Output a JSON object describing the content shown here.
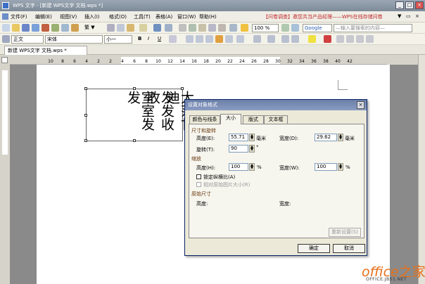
{
  "window": {
    "title": "WPS 文字 - [新建 WPS文字 文档.wps *]",
    "min": "_",
    "max": "□",
    "close": "×"
  },
  "menu": {
    "items": [
      "文件(F)",
      "编辑(E)",
      "视图(V)",
      "插入(I)",
      "格式(O)",
      "工具(T)",
      "表格(A)",
      "窗口(W)",
      "帮助(H)"
    ],
    "promo": "【问卷调查】邀您共当产品经理——WPS在线存储问卷",
    "controls": [
      "▼",
      "▭",
      "×"
    ]
  },
  "toolbar1": {
    "complex": "繁 ▼",
    "zoom": "100 %",
    "google": "Google",
    "search_placeholder": "—输入要搜索的内容—"
  },
  "toolbar2": {
    "style": "正文",
    "font": "宋体",
    "size": "小一",
    "bold": "B",
    "italic": "I",
    "underline": "U"
  },
  "doc_tab": {
    "label": "新建 WPS文字 文档.wps *"
  },
  "ruler": {
    "numbers": [
      "10",
      "8",
      "6",
      "4",
      "2",
      "2",
      "4",
      "6",
      "8",
      "10",
      "12",
      "14",
      "16",
      "18",
      "20",
      "22",
      "24",
      "26",
      "28",
      "30",
      "32",
      "34",
      "36",
      "38",
      "40",
      "42"
    ]
  },
  "textbox": {
    "lines": [
      "大范甘迪",
      "发发收收",
      "室室发发"
    ]
  },
  "dialog": {
    "title": "设置对象格式",
    "tabs": [
      "颜色与线条",
      "大小",
      "版式",
      "文本框"
    ],
    "active_tab": "大小",
    "size_rotate": {
      "section": "尺寸和旋转",
      "height_label": "高度(E):",
      "height_value": "55.71",
      "height_unit": "毫米",
      "width_label": "宽度(D):",
      "width_value": "29.62",
      "width_unit": "毫米",
      "rotate_label": "旋转(T):",
      "rotate_value": "90",
      "rotate_unit": "°"
    },
    "scale": {
      "section": "缩放",
      "height_label": "高度(H):",
      "height_value": "100",
      "height_unit": "%",
      "width_label": "宽度(W):",
      "width_value": "100",
      "width_unit": "%",
      "lock_ratio": "锁定纵横比(A)",
      "relative": "相对原始图片大小(R)"
    },
    "original": {
      "section": "原始尺寸",
      "height_label": "高度:",
      "width_label": "宽度:"
    },
    "reset": "重新设置(S)",
    "ok": "确定",
    "cancel": "取消"
  },
  "watermark": {
    "brand": "office",
    "brand_cn": "之家",
    "site": "OFFICE.JB51.NET"
  },
  "colors": {
    "title_bar": "#7d8a98",
    "dialog_title": "#6b7fa8",
    "section": "#6b3b10",
    "logo": "#e8701a"
  }
}
